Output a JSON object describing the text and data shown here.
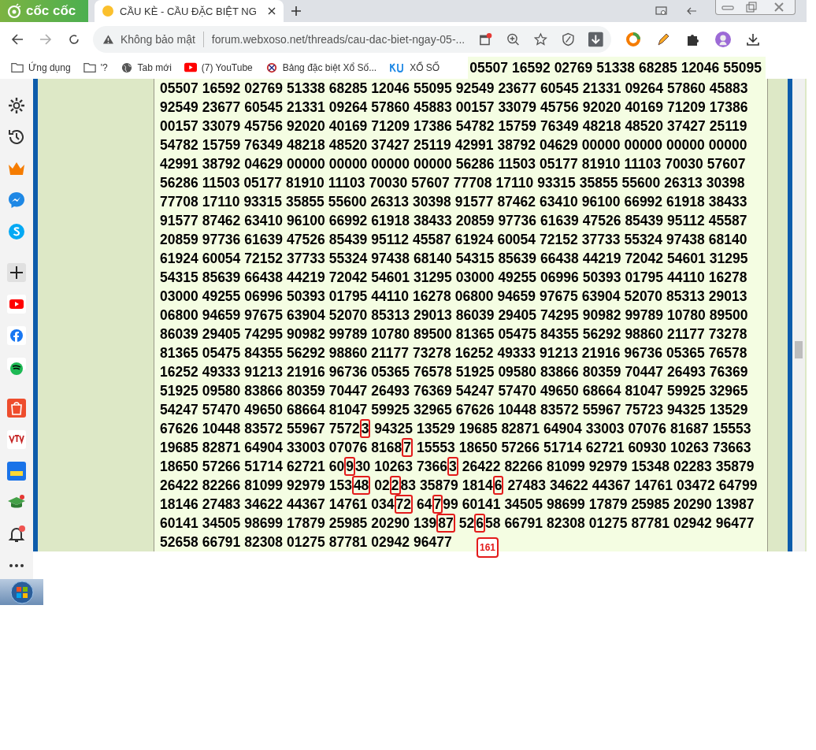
{
  "browser": {
    "logo": "cốc cốc",
    "tab": {
      "title": "CẦU KÈ - CẦU ĐẶC BIỆT NG",
      "selected": true
    },
    "address": {
      "security": "Không bảo mật",
      "url": "forum.webxoso.net/threads/cau-dac-biet-ngay-05-..."
    },
    "bookmarks": [
      {
        "kind": "folder",
        "label": "Ứng dụng"
      },
      {
        "kind": "folder",
        "label": "'?"
      },
      {
        "kind": "globe",
        "label": "Tab mới"
      },
      {
        "kind": "youtube",
        "label": "(7) YouTube"
      },
      {
        "kind": "xs",
        "label": "Bảng đặc biệt Xổ Số..."
      },
      {
        "kind": "ku",
        "label": "XỔ SỐ"
      }
    ]
  },
  "sidebar": [
    {
      "kind": "settings"
    },
    {
      "kind": "history"
    },
    {
      "kind": "crown"
    },
    {
      "kind": "messenger"
    },
    {
      "kind": "skype"
    },
    {
      "kind": "divider"
    },
    {
      "kind": "add"
    },
    {
      "kind": "youtube"
    },
    {
      "kind": "facebook"
    },
    {
      "kind": "spotify"
    },
    {
      "kind": "divider"
    },
    {
      "kind": "shop"
    },
    {
      "kind": "tv"
    },
    {
      "kind": "store"
    },
    {
      "kind": "cap"
    },
    {
      "kind": "bell"
    },
    {
      "kind": "more"
    }
  ],
  "top_row": [
    "05507",
    "16592",
    "02769",
    "51338",
    "68285",
    "12046",
    "55095"
  ],
  "rows": [
    {
      "groups": [
        "05507",
        "16592",
        "02769",
        "51338",
        "68285",
        "12046",
        "55095",
        "92549",
        "23677",
        "60545",
        "21331",
        "09264",
        "57860",
        "45883"
      ]
    },
    {
      "groups": [
        "92549",
        "23677",
        "60545",
        "21331",
        "09264",
        "57860",
        "45883",
        "00157",
        "33079",
        "45756",
        "92020",
        "40169",
        "71209",
        "17386"
      ]
    },
    {
      "groups": [
        "00157",
        "33079",
        "45756",
        "92020",
        "40169",
        "71209",
        "17386",
        "54782",
        "15759",
        "76349",
        "48218",
        "48520",
        "37427",
        "25119"
      ]
    },
    {
      "groups": [
        "54782",
        "15759",
        "76349",
        "48218",
        "48520",
        "37427",
        "25119",
        "42991",
        "38792",
        "04629",
        "00000",
        "00000",
        "00000",
        "00000"
      ]
    },
    {
      "groups": [
        "42991",
        "38792",
        "04629",
        "00000",
        "00000",
        "00000",
        "00000",
        "56286",
        "11503",
        "05177",
        "81910",
        "11103",
        "70030",
        "57607"
      ]
    },
    {
      "groups": [
        "56286",
        "11503",
        "05177",
        "81910",
        "11103",
        "70030",
        "57607",
        "77708",
        "17110",
        "93315",
        "35855",
        "55600",
        "26313",
        "30398"
      ]
    },
    {
      "groups": [
        "77708",
        "17110",
        "93315",
        "35855",
        "55600",
        "26313",
        "30398",
        "91577",
        "87462",
        "63410",
        "96100",
        "66992",
        "61918",
        "38433"
      ]
    },
    {
      "groups": [
        "91577",
        "87462",
        "63410",
        "96100",
        "66992",
        "61918",
        "38433",
        "20859",
        "97736",
        "61639",
        "47526",
        "85439",
        "95112",
        "45587"
      ]
    },
    {
      "groups": [
        "20859",
        "97736",
        "61639",
        "47526",
        "85439",
        "95112",
        "45587",
        "61924",
        "60054",
        "72152",
        "37733",
        "55324",
        "97438",
        "68140"
      ]
    },
    {
      "groups": [
        "61924",
        "60054",
        "72152",
        "37733",
        "55324",
        "97438",
        "68140",
        "54315",
        "85639",
        "66438",
        "44219",
        "72042",
        "54601",
        "31295"
      ]
    },
    {
      "groups": [
        "54315",
        "85639",
        "66438",
        "44219",
        "72042",
        "54601",
        "31295",
        "03000",
        "49255",
        "06996",
        "50393",
        "01795",
        "44110",
        "16278"
      ]
    },
    {
      "groups": [
        "03000",
        "49255",
        "06996",
        "50393",
        "01795",
        "44110",
        "16278",
        "06800",
        "94659",
        "97675",
        "63904",
        "52070",
        "85313",
        "29013"
      ]
    },
    {
      "groups": [
        "06800",
        "94659",
        "97675",
        "63904",
        "52070",
        "85313",
        "29013",
        "86039",
        "29405",
        "74295",
        "90982",
        "99789",
        "10780",
        "89500"
      ]
    },
    {
      "groups": [
        "86039",
        "29405",
        "74295",
        "90982",
        "99789",
        "10780",
        "89500",
        "81365",
        "05475",
        "84355",
        "56292",
        "98860",
        "21177",
        "73278"
      ]
    },
    {
      "groups": [
        "81365",
        "05475",
        "84355",
        "56292",
        "98860",
        "21177",
        "73278",
        "16252",
        "49333",
        "91213",
        "21916",
        "96736",
        "05365",
        "76578"
      ]
    },
    {
      "groups": [
        "16252",
        "49333",
        "91213",
        "21916",
        "96736",
        "05365",
        "76578",
        "51925",
        "09580",
        "83866",
        "80359",
        "70447",
        "26493",
        "76369"
      ]
    },
    {
      "groups": [
        "51925",
        "09580",
        "83866",
        "80359",
        "70447",
        "26493",
        "76369",
        "54247",
        "57470",
        "49650",
        "68664",
        "81047",
        "59925",
        "32965"
      ]
    },
    {
      "groups": [
        "54247",
        "57470",
        "49650",
        "68664",
        "81047",
        "59925",
        "32965",
        "67626",
        "10448",
        "83572",
        "55967",
        "75723",
        "94325",
        "13529"
      ]
    },
    {
      "groups": [
        "67626",
        "10448",
        "83572",
        "55967",
        {
          "before": "7572",
          "marked": "3"
        },
        "94325",
        "13529",
        "19685",
        "82871",
        "64904",
        "33003",
        "07076",
        "81687",
        "15553"
      ]
    },
    {
      "groups": [
        "19685",
        "82871",
        "64904",
        "33003",
        "07076",
        {
          "before": "8168",
          "marked": "7"
        },
        "15553",
        "18650",
        "57266",
        "51714",
        "62721",
        "60930",
        "10263",
        "73663"
      ]
    },
    {
      "groups": [
        "18650",
        "57266",
        "51714",
        "62721",
        {
          "before": "60",
          "marked": "9",
          "after": "30"
        },
        "10263",
        {
          "before": "7366",
          "marked": "3"
        },
        "26422",
        "82266",
        "81099",
        "92979",
        "15348",
        "02283",
        "35879"
      ]
    },
    {
      "groups": [
        "26422",
        "82266",
        "81099",
        "92979",
        {
          "before": "153",
          "marked": "48"
        },
        {
          "before": "02",
          "marked": "2",
          "after": "83"
        },
        "35879",
        {
          "before": "1814",
          "marked": "6"
        },
        "27483",
        "34622",
        "44367",
        "14761",
        "03472",
        "64799"
      ]
    },
    {
      "groups": [
        "18146",
        "27483",
        "34622",
        "44367",
        "14761",
        {
          "before": "034",
          "marked": "72"
        },
        {
          "before": "64",
          "marked": "7",
          "after": "99"
        },
        "60141",
        "34505",
        "98699",
        "17879",
        "25985",
        "20290",
        "13987"
      ]
    },
    {
      "groups": [
        "60141",
        "34505",
        "98699",
        "17879",
        "25985",
        "20290",
        {
          "before": "139",
          "marked": "87"
        },
        {
          "before": "52",
          "marked": "6",
          "after": "58"
        },
        "66791",
        "82308",
        "01275",
        "87781",
        "02942",
        "96477"
      ]
    },
    {
      "groups": [
        "52658",
        "66791",
        "82308",
        "01275",
        "87781",
        "02942",
        "96477"
      ],
      "note": "161"
    }
  ]
}
